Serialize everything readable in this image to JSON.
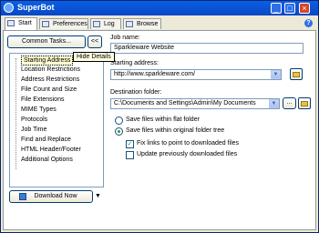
{
  "window": {
    "title": "SuperBot"
  },
  "tabs": [
    {
      "label": "Start"
    },
    {
      "label": "Preferences"
    },
    {
      "label": "Log"
    },
    {
      "label": "Browse"
    }
  ],
  "sidebar": {
    "common_tasks_label": "Common Tasks...",
    "hide_details_label": "<<",
    "tooltip": "Hide Details",
    "items": [
      {
        "label": "Starting Address"
      },
      {
        "label": "Location Restrictions"
      },
      {
        "label": "Address Restrictions"
      },
      {
        "label": "File Count and Size"
      },
      {
        "label": "File Extensions"
      },
      {
        "label": "MIME Types"
      },
      {
        "label": "Protocols"
      },
      {
        "label": "Job Time"
      },
      {
        "label": "Find and Replace"
      },
      {
        "label": "HTML Header/Footer"
      },
      {
        "label": "Additional Options"
      }
    ],
    "download_label": "Download Now"
  },
  "form": {
    "job_name_label": "Job name:",
    "job_name_value": "Sparkleware Website",
    "starting_address_label": "Starting address:",
    "starting_address_value": "http://www.sparkleware.com/",
    "destination_label": "Destination folder:",
    "destination_value": "C:\\Documents and Settings\\Admin\\My Documents",
    "browse_label": "...",
    "radio_flat": "Save files within flat folder",
    "radio_tree": "Save files within original folder tree",
    "check_fix": "Fix links to point to downloaded files",
    "check_update": "Update previously downloaded files"
  }
}
